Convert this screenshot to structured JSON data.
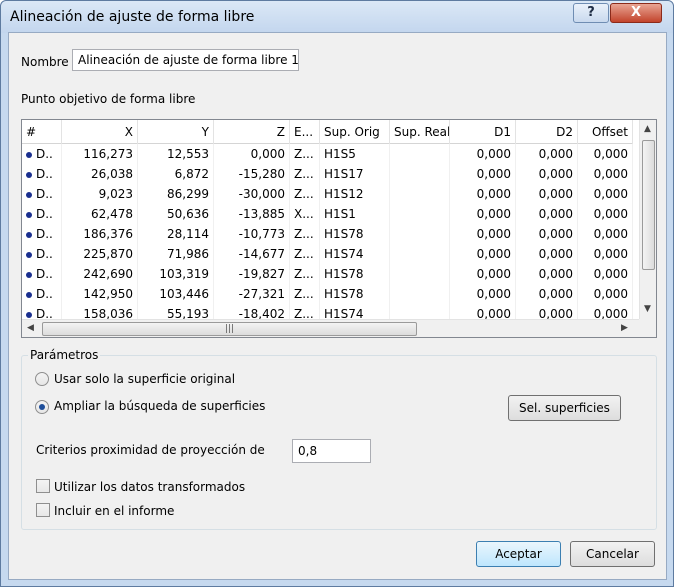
{
  "window": {
    "title": "Alineación de ajuste de forma libre",
    "help_label": "?",
    "close_label": "X"
  },
  "nombre": {
    "label": "Nombre",
    "value": "Alineación de ajuste de forma libre 1"
  },
  "section_label": "Punto objetivo de forma libre",
  "table": {
    "columns": [
      "#",
      "X",
      "Y",
      "Z",
      "E...",
      "Sup. Orig",
      "Sup. Real",
      "D1",
      "D2",
      "Offset"
    ],
    "rows": [
      [
        "D..",
        "116,273",
        "12,553",
        "0,000",
        "Z...",
        "H1S5",
        "",
        "0,000",
        "0,000",
        "0,000"
      ],
      [
        "D..",
        "26,038",
        "6,872",
        "-15,280",
        "Z...",
        "H1S17",
        "",
        "0,000",
        "0,000",
        "0,000"
      ],
      [
        "D..",
        "9,023",
        "86,299",
        "-30,000",
        "Z...",
        "H1S12",
        "",
        "0,000",
        "0,000",
        "0,000"
      ],
      [
        "D..",
        "62,478",
        "50,636",
        "-13,885",
        "X...",
        "H1S1",
        "",
        "0,000",
        "0,000",
        "0,000"
      ],
      [
        "D..",
        "186,376",
        "28,114",
        "-10,773",
        "Z...",
        "H1S78",
        "",
        "0,000",
        "0,000",
        "0,000"
      ],
      [
        "D..",
        "225,870",
        "71,986",
        "-14,677",
        "Z...",
        "H1S74",
        "",
        "0,000",
        "0,000",
        "0,000"
      ],
      [
        "D..",
        "242,690",
        "103,319",
        "-19,827",
        "Z...",
        "H1S78",
        "",
        "0,000",
        "0,000",
        "0,000"
      ],
      [
        "D..",
        "142,950",
        "103,446",
        "-27,321",
        "Z...",
        "H1S78",
        "",
        "0,000",
        "0,000",
        "0,000"
      ],
      [
        "D..",
        "158,036",
        "55,193",
        "-18,402",
        "Z...",
        "H1S74",
        "",
        "0,000",
        "0,000",
        "0,000"
      ]
    ]
  },
  "params": {
    "title": "Parámetros",
    "radio_original": "Usar solo la superficie original",
    "radio_extend": "Ampliar la búsqueda de superficies",
    "sel_button": "Sel. superficies",
    "criteria_label": "Criterios proximidad de proyección de",
    "criteria_value": "0,8",
    "check_transformed": "Utilizar los datos transformados",
    "check_report": "Incluir en el informe"
  },
  "buttons": {
    "accept": "Aceptar",
    "cancel": "Cancelar"
  }
}
